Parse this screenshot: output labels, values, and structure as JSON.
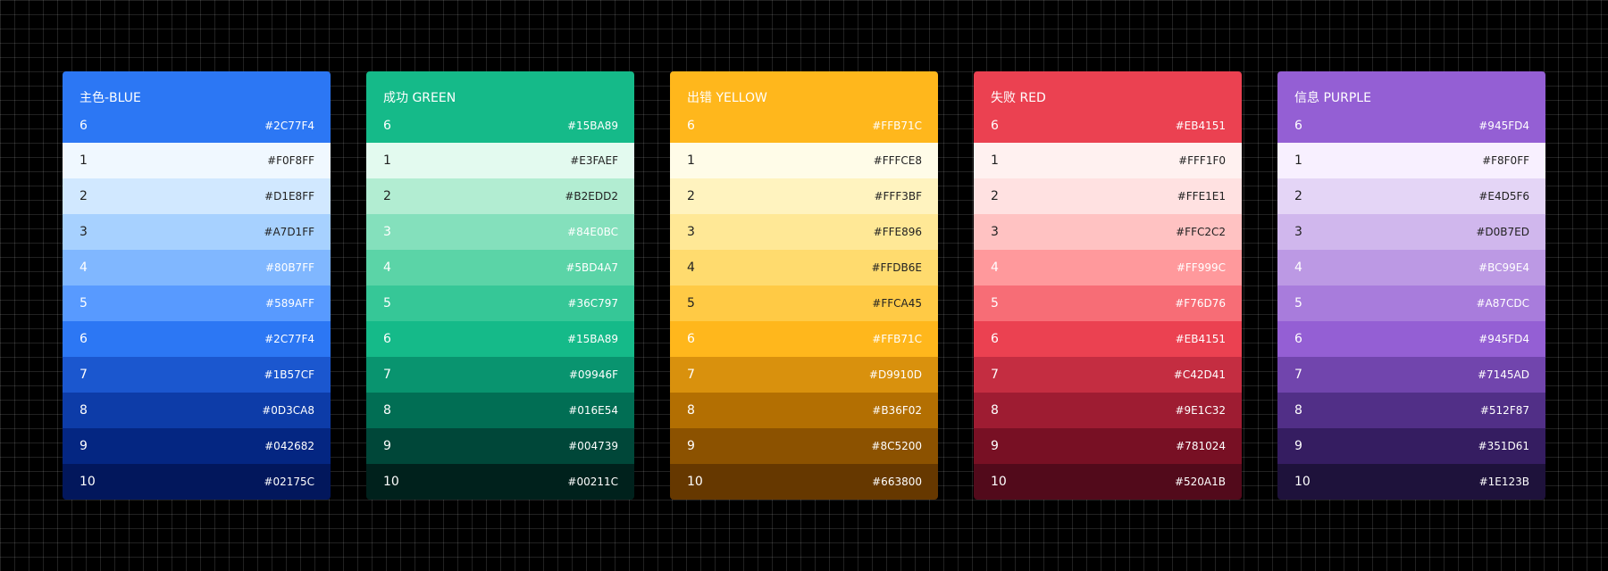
{
  "palettes": [
    {
      "title": "主色-BLUE",
      "primary": {
        "step": "6",
        "hex": "#2C77F4"
      },
      "swatches": [
        {
          "step": "1",
          "hex": "#F0F8FF"
        },
        {
          "step": "2",
          "hex": "#D1E8FF"
        },
        {
          "step": "3",
          "hex": "#A7D1FF"
        },
        {
          "step": "4",
          "hex": "#80B7FF"
        },
        {
          "step": "5",
          "hex": "#589AFF"
        },
        {
          "step": "6",
          "hex": "#2C77F4"
        },
        {
          "step": "7",
          "hex": "#1B57CF"
        },
        {
          "step": "8",
          "hex": "#0D3CA8"
        },
        {
          "step": "9",
          "hex": "#042682"
        },
        {
          "step": "10",
          "hex": "#02175C"
        }
      ]
    },
    {
      "title": "成功 GREEN",
      "primary": {
        "step": "6",
        "hex": "#15BA89"
      },
      "swatches": [
        {
          "step": "1",
          "hex": "#E3FAEF"
        },
        {
          "step": "2",
          "hex": "#B2EDD2"
        },
        {
          "step": "3",
          "hex": "#84E0BC"
        },
        {
          "step": "4",
          "hex": "#5BD4A7"
        },
        {
          "step": "5",
          "hex": "#36C797"
        },
        {
          "step": "6",
          "hex": "#15BA89"
        },
        {
          "step": "7",
          "hex": "#09946F"
        },
        {
          "step": "8",
          "hex": "#016E54"
        },
        {
          "step": "9",
          "hex": "#004739"
        },
        {
          "step": "10",
          "hex": "#00211C"
        }
      ]
    },
    {
      "title": "出错 YELLOW",
      "primary": {
        "step": "6",
        "hex": "#FFB71C"
      },
      "swatches": [
        {
          "step": "1",
          "hex": "#FFFCE8"
        },
        {
          "step": "2",
          "hex": "#FFF3BF"
        },
        {
          "step": "3",
          "hex": "#FFE896"
        },
        {
          "step": "4",
          "hex": "#FFDB6E"
        },
        {
          "step": "5",
          "hex": "#FFCA45"
        },
        {
          "step": "6",
          "hex": "#FFB71C"
        },
        {
          "step": "7",
          "hex": "#D9910D"
        },
        {
          "step": "8",
          "hex": "#B36F02"
        },
        {
          "step": "9",
          "hex": "#8C5200"
        },
        {
          "step": "10",
          "hex": "#663800"
        }
      ]
    },
    {
      "title": "失败 RED",
      "primary": {
        "step": "6",
        "hex": "#EB4151"
      },
      "swatches": [
        {
          "step": "1",
          "hex": "#FFF1F0"
        },
        {
          "step": "2",
          "hex": "#FFE1E1"
        },
        {
          "step": "3",
          "hex": "#FFC2C2"
        },
        {
          "step": "4",
          "hex": "#FF999C"
        },
        {
          "step": "5",
          "hex": "#F76D76"
        },
        {
          "step": "6",
          "hex": "#EB4151"
        },
        {
          "step": "7",
          "hex": "#C42D41"
        },
        {
          "step": "8",
          "hex": "#9E1C32"
        },
        {
          "step": "9",
          "hex": "#781024"
        },
        {
          "step": "10",
          "hex": "#520A1B"
        }
      ]
    },
    {
      "title": "信息 PURPLE",
      "primary": {
        "step": "6",
        "hex": "#945FD4"
      },
      "swatches": [
        {
          "step": "1",
          "hex": "#F8F0FF"
        },
        {
          "step": "2",
          "hex": "#E4D5F6"
        },
        {
          "step": "3",
          "hex": "#D0B7ED"
        },
        {
          "step": "4",
          "hex": "#BC99E4"
        },
        {
          "step": "5",
          "hex": "#A87CDC"
        },
        {
          "step": "6",
          "hex": "#945FD4"
        },
        {
          "step": "7",
          "hex": "#7145AD"
        },
        {
          "step": "8",
          "hex": "#512F87"
        },
        {
          "step": "9",
          "hex": "#351D61"
        },
        {
          "step": "10",
          "hex": "#1E123B"
        }
      ]
    }
  ]
}
